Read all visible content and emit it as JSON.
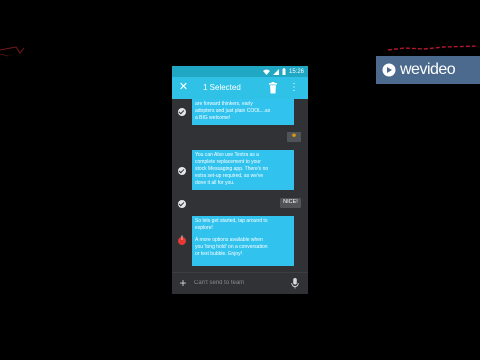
{
  "status_bar": {
    "time": "15:26",
    "icons": [
      "wifi-icon",
      "signal-icon",
      "battery-icon"
    ]
  },
  "toolbar": {
    "title": "1 Selected",
    "close_icon": "close-icon",
    "delete_icon": "trash-icon",
    "more_icon": "more-vert-icon"
  },
  "messages": [
    {
      "type": "outgoing",
      "lines": [
        "are forward thinkers, early",
        "adopters and just plain COOL...so",
        "a BIG welcome!"
      ]
    },
    {
      "type": "reply",
      "text": "☻"
    },
    {
      "type": "outgoing",
      "lines": [
        "You can Also use Textra as a",
        "complete replacement to your",
        "stock Messaging app. There's no",
        "extra set-up required, as we've",
        "done it all for you."
      ]
    },
    {
      "type": "reply",
      "text": "NICE!"
    },
    {
      "type": "outgoing_error",
      "lines": [
        "So lets get started, tap around to",
        "explore!"
      ],
      "lines2": [
        "A more options available when",
        "you 'long hold' on a conversation",
        "or text bubble. Enjoy!"
      ]
    }
  ],
  "composer": {
    "placeholder": "Can't send to team",
    "add_icon": "plus-icon",
    "mic_icon": "mic-icon"
  },
  "watermark": {
    "brand": "wevideo",
    "icon": "wevideo-play-icon"
  },
  "colors": {
    "background": "#000000",
    "statusbar": "#1fa7c4",
    "toolbar": "#2fc2e6",
    "bubble": "#31c3ee",
    "thread_bg": "#303236",
    "error": "#e53935",
    "watermark_bg": "#4b6a8d",
    "watermark_bar_red": "#b0192e"
  }
}
